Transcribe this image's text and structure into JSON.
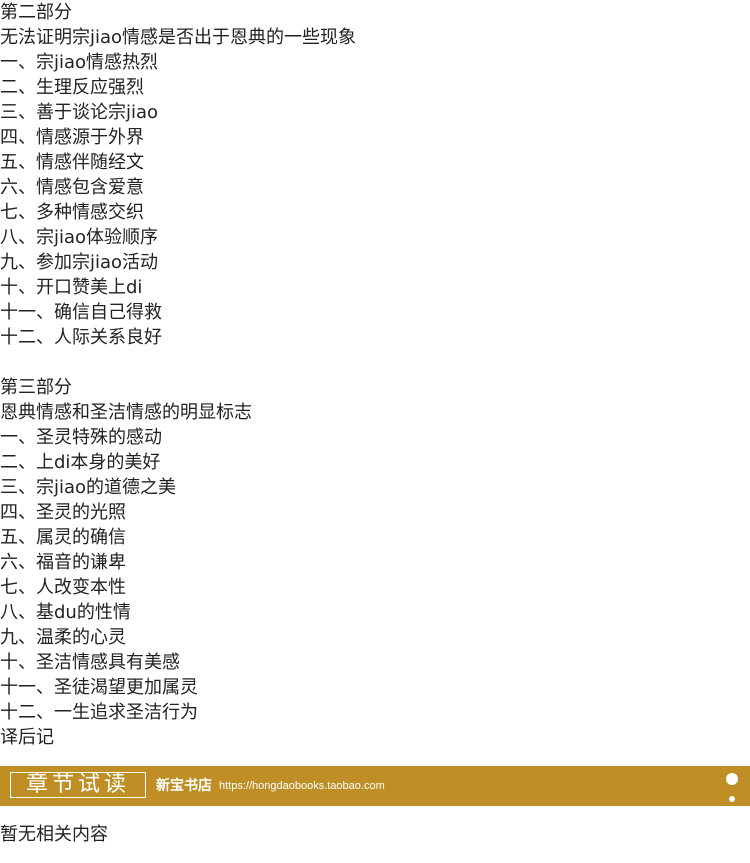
{
  "toc": {
    "part2": {
      "heading": "第二部分",
      "subtitle": "无法证明宗jiao情感是否出于恩典的一些现象",
      "items": [
        "一、宗jiao情感热烈",
        "二、生理反应强烈",
        "三、善于谈论宗jiao",
        "四、情感源于外界",
        "五、情感伴随经文",
        "六、情感包含爱意",
        "七、多种情感交织",
        "八、宗jiao体验顺序",
        "九、参加宗jiao活动",
        "十、开口赞美上di",
        "十一、确信自己得救",
        "十二、人际关系良好"
      ]
    },
    "part3": {
      "heading": "第三部分",
      "subtitle": "恩典情感和圣洁情感的明显标志",
      "items": [
        "一、圣灵特殊的感动",
        "二、上di本身的美好",
        "三、宗jiao的道德之美",
        "四、圣灵的光照",
        "五、属灵的确信",
        "六、福音的谦卑",
        "七、人改变本性",
        "八、基du的性情",
        "九、温柔的心灵",
        "十、圣洁情感具有美感",
        "十一、圣徒渴望更加属灵",
        "十二、一生追求圣洁行为"
      ]
    },
    "afterword": "译后记"
  },
  "banner": {
    "title": "章节试读",
    "shop": "新宝书店",
    "url": "https://hongdaobooks.taobao.com",
    "color": "#bf8f26"
  },
  "empty_note": "暂无相关内容"
}
